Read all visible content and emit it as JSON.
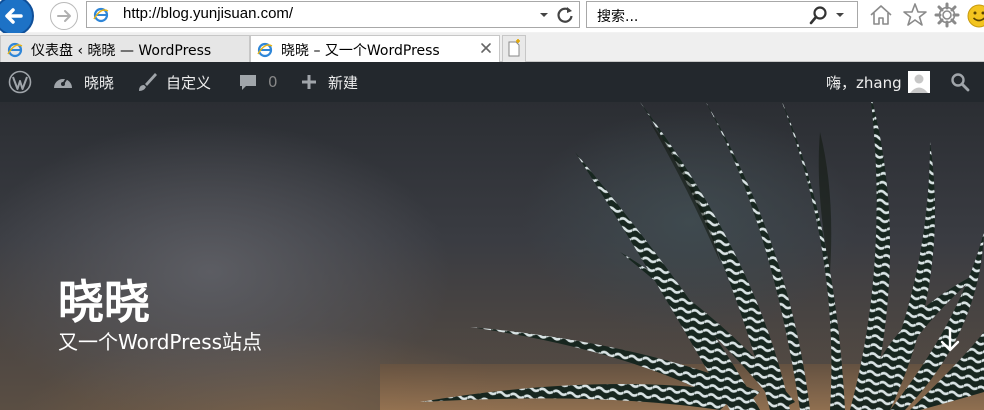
{
  "browser": {
    "address": "http://blog.yunjisuan.com/",
    "search_placeholder": "搜索...",
    "tabs": [
      {
        "label": "仪表盘 ‹ 晓晓 — WordPress",
        "active": false
      },
      {
        "label": "晓晓 – 又一个WordPress",
        "active": true
      }
    ]
  },
  "adminbar": {
    "site_name": "晓晓",
    "customize": "自定义",
    "comments_count": "0",
    "new": "新建",
    "greeting": "嗨，zhang"
  },
  "hero": {
    "title": "晓晓",
    "description": "又一个WordPress站点"
  },
  "colors": {
    "adminbar_bg": "#23282d",
    "ie_blue": "#1d72c6"
  }
}
